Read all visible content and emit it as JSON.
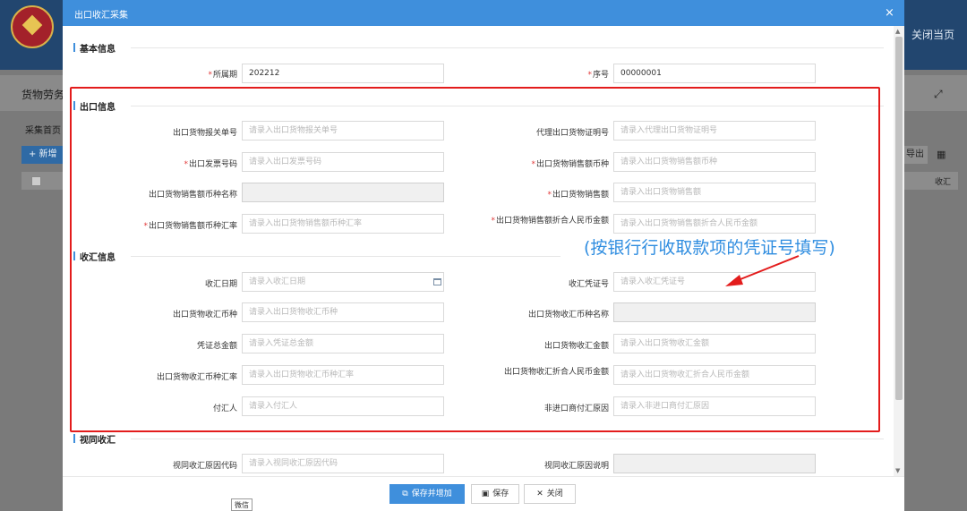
{
  "background": {
    "close_page": "关闭当页",
    "breadcrumb": "货物劳务",
    "tab": "采集首页",
    "add_button": "+ 新增",
    "export_button": "导出",
    "table_col": "收汇"
  },
  "modal": {
    "title": "出口收汇采集",
    "close_glyph": "×"
  },
  "sections": {
    "basic": "基本信息",
    "export": "出口信息",
    "receipt": "收汇信息",
    "deemed": "视同收汇"
  },
  "fields": {
    "period": {
      "label": "所属期",
      "required": "*",
      "value": "202212"
    },
    "seq": {
      "label": "序号",
      "required": "*",
      "value": "00000001"
    },
    "customs_no": {
      "label": "出口货物报关单号",
      "placeholder": "请录入出口货物报关单号"
    },
    "agent_cert": {
      "label": "代理出口货物证明号",
      "placeholder": "请录入代理出口货物证明号"
    },
    "invoice_no": {
      "label": "出口发票号码",
      "required": "*",
      "placeholder": "请录入出口发票号码"
    },
    "sales_currency": {
      "label": "出口货物销售额币种",
      "required": "*",
      "placeholder": "请录入出口货物销售额币种"
    },
    "sales_currency_name": {
      "label": "出口货物销售额币种名称"
    },
    "sales_amount": {
      "label": "出口货物销售额",
      "required": "*",
      "placeholder": "请录入出口货物销售额"
    },
    "sales_rate": {
      "label": "出口货物销售额币种汇率",
      "required": "*",
      "placeholder": "请录入出口货物销售额币种汇率"
    },
    "sales_rmb": {
      "label": "出口货物销售额折合人民币金额",
      "required": "*",
      "placeholder": "请录入出口货物销售额折合人民币金额"
    },
    "receipt_date": {
      "label": "收汇日期",
      "placeholder": "请录入收汇日期"
    },
    "receipt_voucher": {
      "label": "收汇凭证号",
      "placeholder": "请录入收汇凭证号"
    },
    "receipt_currency": {
      "label": "出口货物收汇币种",
      "placeholder": "请录入出口货物收汇币种"
    },
    "receipt_currency_name": {
      "label": "出口货物收汇币种名称"
    },
    "voucher_total": {
      "label": "凭证总金额",
      "placeholder": "请录入凭证总金额"
    },
    "receipt_amount": {
      "label": "出口货物收汇金额",
      "placeholder": "请录入出口货物收汇金额"
    },
    "receipt_rate": {
      "label": "出口货物收汇币种汇率",
      "placeholder": "请录入出口货物收汇币种汇率"
    },
    "receipt_rmb": {
      "label": "出口货物收汇折合人民币金额",
      "placeholder": "请录入出口货物收汇折合人民币金额"
    },
    "payer": {
      "label": "付汇人",
      "placeholder": "请录入付汇人"
    },
    "non_importer_reason": {
      "label": "非进口商付汇原因",
      "placeholder": "请录入非进口商付汇原因"
    },
    "deemed_code": {
      "label": "视同收汇原因代码",
      "placeholder": "请录入视同收汇原因代码"
    },
    "deemed_desc": {
      "label": "视同收汇原因说明"
    }
  },
  "annotation": "(按银行行收取款项的凭证号填写)",
  "footer": {
    "save_add": "保存并增加",
    "save": "保存",
    "close": "关闭"
  },
  "tooltip": "微信",
  "colors": {
    "primary": "#3f8fdc",
    "required": "#e23b3b",
    "highlight_box": "#e31c1c",
    "annotation": "#2f8de0"
  }
}
